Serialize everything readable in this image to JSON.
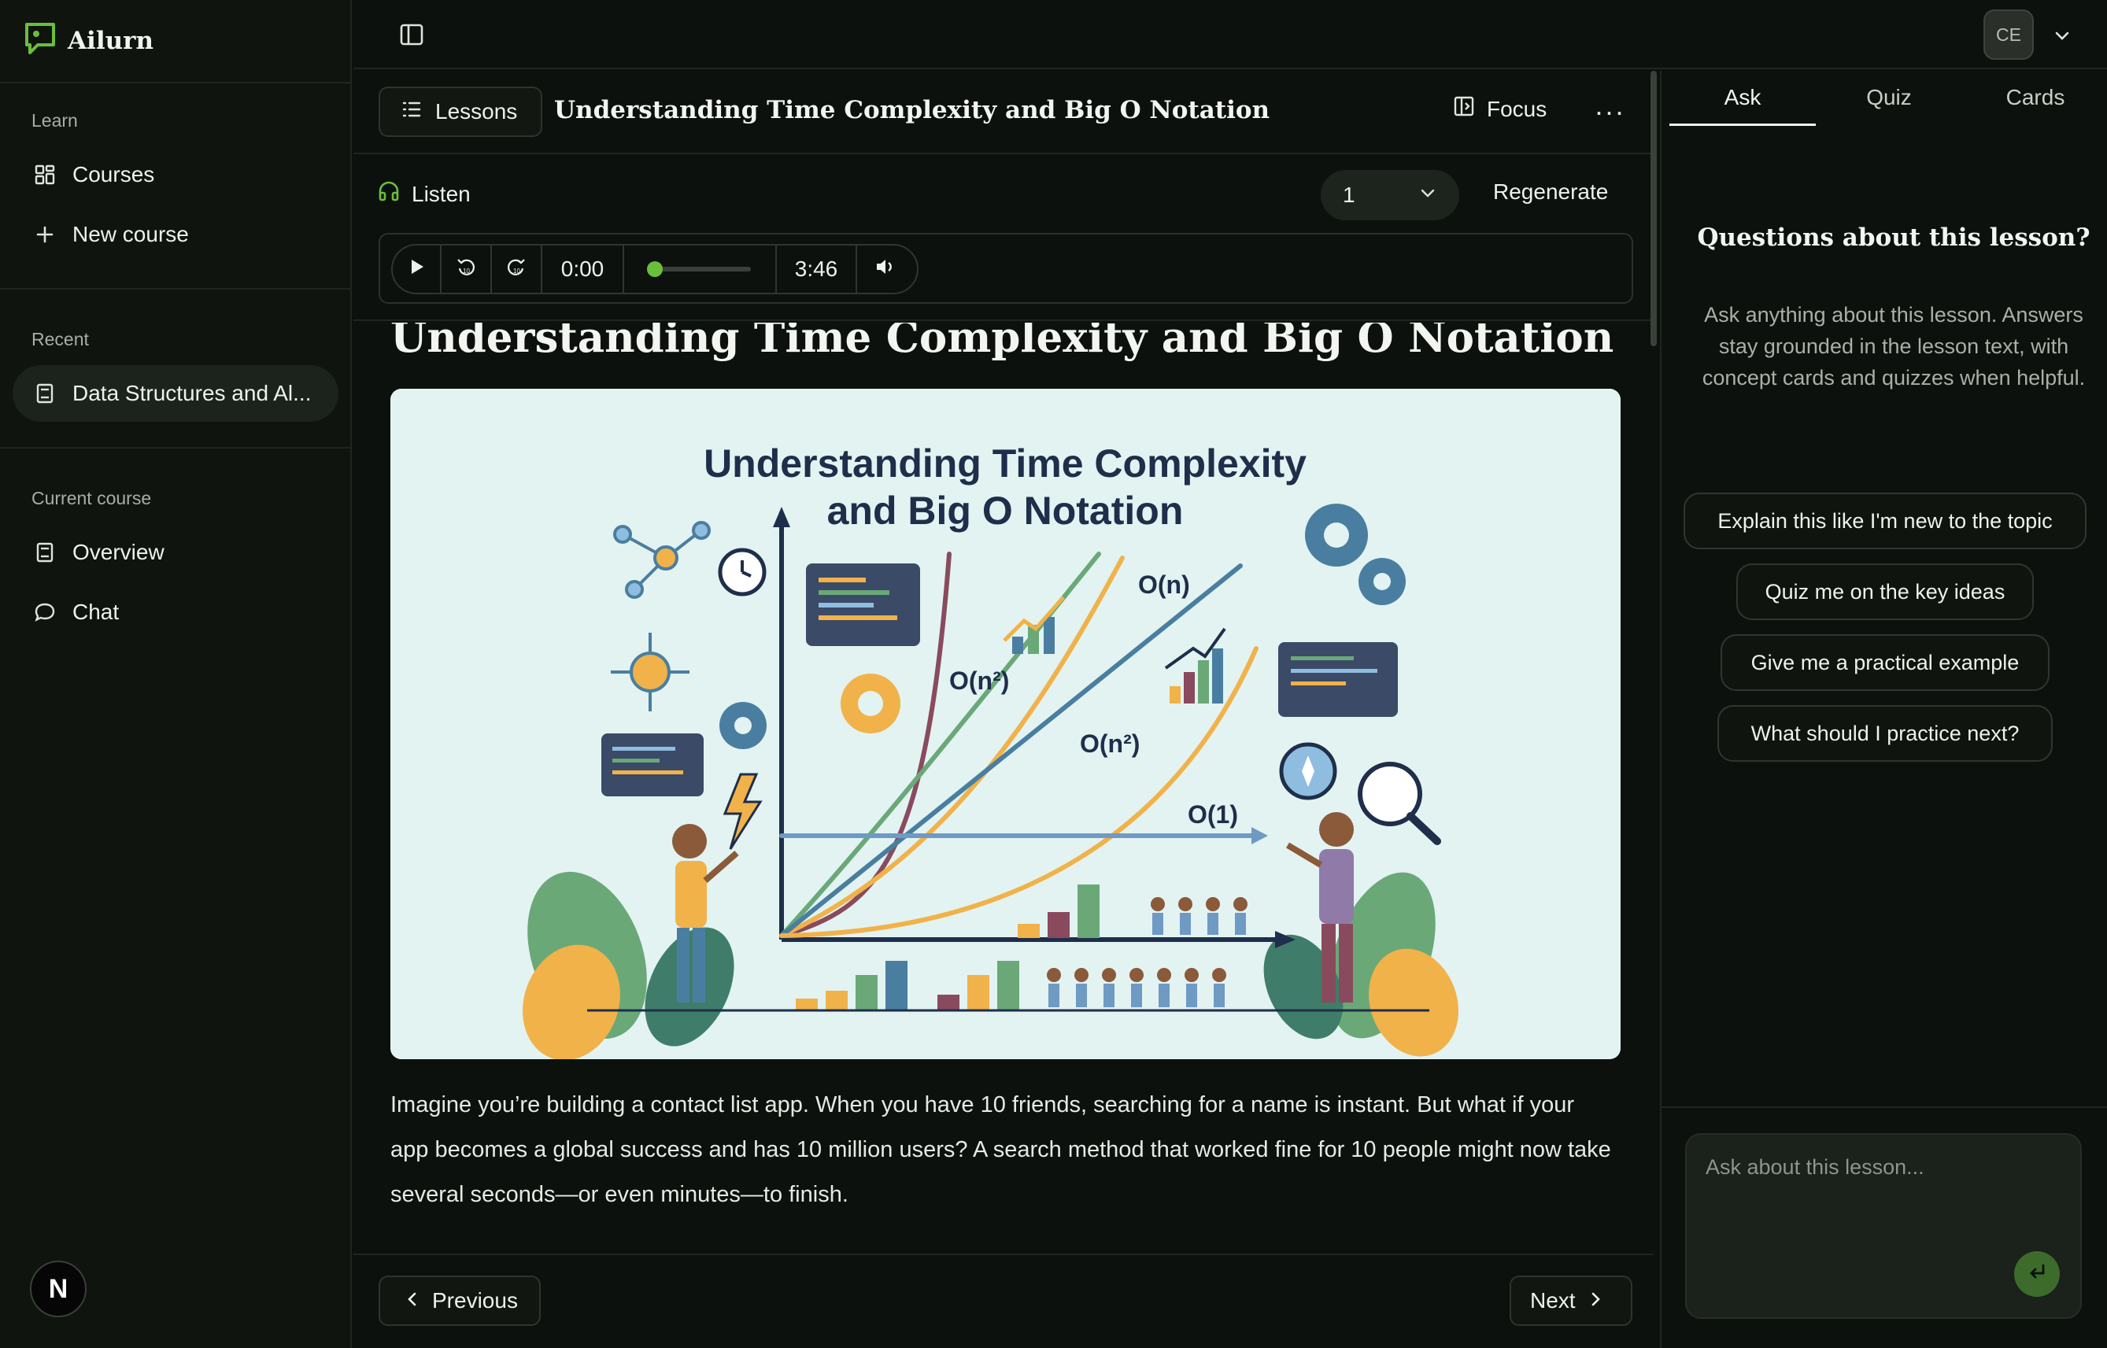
{
  "app": {
    "name": "Ailurn",
    "avatar_initials": "CE",
    "corner_badge": "N"
  },
  "sidebar": {
    "learn_label": "Learn",
    "courses_label": "Courses",
    "new_course_label": "New course",
    "recent_label": "Recent",
    "recent_item": "Data Structures and Al...",
    "current_course_label": "Current course",
    "overview_label": "Overview",
    "chat_label": "Chat"
  },
  "lesson_header": {
    "lessons_label": "Lessons",
    "title": "Understanding Time Complexity and Big O Notation",
    "focus_label": "Focus",
    "more_label": "···"
  },
  "listen": {
    "label": "Listen",
    "voice_value": "1",
    "regenerate_label": "Regenerate",
    "current_time": "0:00",
    "duration": "3:46",
    "progress": 0.0
  },
  "content": {
    "heading": "Understanding Time Complexity and Big O Notation",
    "hero": {
      "title_line1": "Understanding Time Complexity",
      "title_line2": "and Big O Notation",
      "label_on": "O(n)",
      "label_on2_a": "O(n²)",
      "label_on2_b": "O(n²)",
      "label_o1": "O(1)"
    },
    "paragraph": "Imagine you’re building a contact list app. When you have 10 friends, searching for a name is instant. But what if your app becomes a global success and has 10 million users? A search method that worked fine for 10 people might now take several seconds—or even minutes—to finish."
  },
  "nav": {
    "previous_label": "Previous",
    "next_label": "Next"
  },
  "right_panel": {
    "tabs": [
      "Ask",
      "Quiz",
      "Cards"
    ],
    "heading": "Questions about this lesson?",
    "subtext": "Ask anything about this lesson. Answers stay grounded in the lesson text, with concept cards and quizzes when helpful.",
    "suggestions": [
      "Explain this like I'm new to the topic",
      "Quiz me on the key ideas",
      "Give me a practical example",
      "What should I practice next?"
    ],
    "input_placeholder": "Ask about this lesson..."
  },
  "colors": {
    "accent": "#6abf3a",
    "send": "#3d6b2c",
    "background": "#0d110d",
    "hero_bg": "#e2f3f2"
  }
}
